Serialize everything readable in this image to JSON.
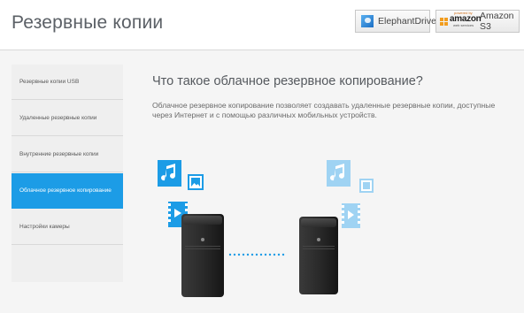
{
  "header": {
    "title": "Резервные копии",
    "elephantdrive_label": "ElephantDrive",
    "amazon_label": "Amazon S3",
    "amazon_logo": {
      "top_text": "powered by",
      "word": "amazon",
      "bottom_text": "web services"
    }
  },
  "sidebar": {
    "items": [
      {
        "label": "Резервные копии USB",
        "active": false
      },
      {
        "label": "Удаленные резервные копии",
        "active": false
      },
      {
        "label": "Внутренние резервные копии",
        "active": false
      },
      {
        "label": "Облачное резервное копирование",
        "active": true
      },
      {
        "label": "Настройки камеры",
        "active": false
      }
    ]
  },
  "main": {
    "heading": "Что такое облачное резервное копирование?",
    "description": "Облачное резервное копирование позволяет создавать удаленные резервные копии, доступные через Интернет и с помощью различных мобильных устройств."
  },
  "illustration": {
    "icons": [
      "music-note-icon",
      "image-icon",
      "video-icon",
      "nas-device-icon",
      "sync-dots-icon"
    ],
    "colors": {
      "primary_blue": "#1c9ce6",
      "faded_blue": "#9fd3f3",
      "dots_blue": "#1c9ce6"
    }
  },
  "colors": {
    "accent": "#1c9ce6",
    "sidebar_bg": "#efefef",
    "content_bg": "#f5f5f5"
  }
}
